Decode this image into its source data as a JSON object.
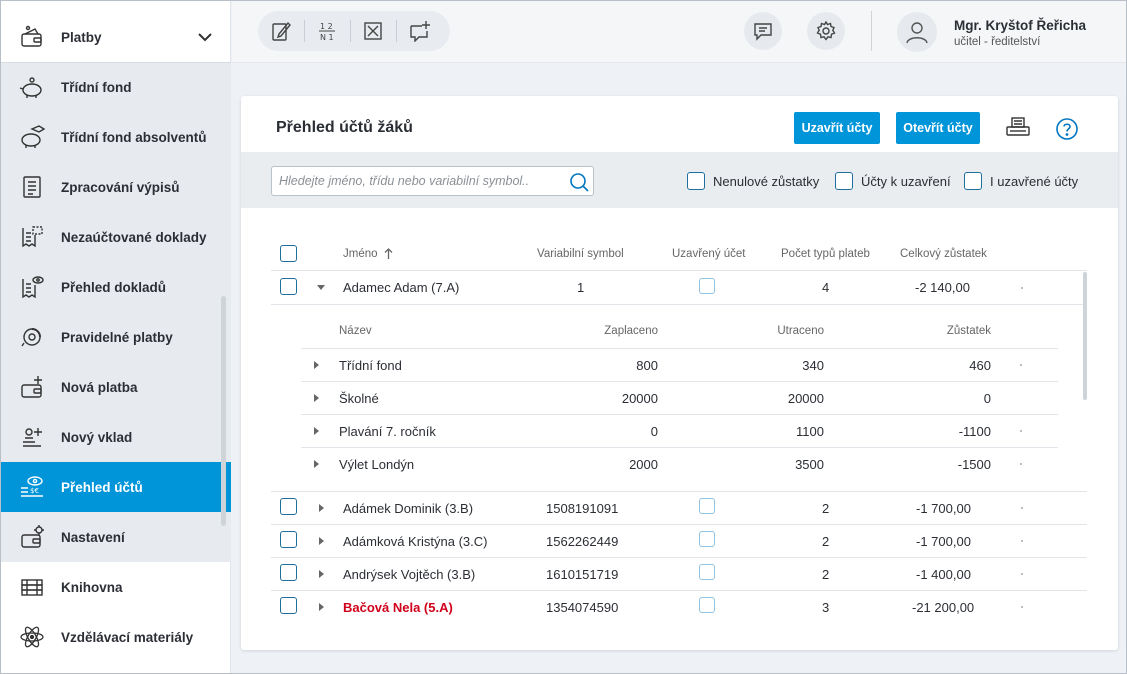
{
  "sidebar": {
    "header": {
      "label": "Platby",
      "icon": "wallet-icon"
    },
    "items": [
      {
        "label": "Třídní fond",
        "icon": "piggy-bank-icon"
      },
      {
        "label": "Třídní fond absolventů",
        "icon": "piggy-bank-graduate-icon"
      },
      {
        "label": "Zpracování výpisů",
        "icon": "statement-icon"
      },
      {
        "label": "Nezaúčtované doklady",
        "icon": "receipt-dashed-icon"
      },
      {
        "label": "Přehled dokladů",
        "icon": "receipt-eye-icon"
      },
      {
        "label": "Pravidelné platby",
        "icon": "recurring-payment-icon"
      },
      {
        "label": "Nová platba",
        "icon": "wallet-plus-icon"
      },
      {
        "label": "Nový vklad",
        "icon": "coins-plus-icon"
      },
      {
        "label": "Přehled účtů",
        "icon": "accounts-eye-icon",
        "active": true
      },
      {
        "label": "Nastavení",
        "icon": "wallet-gear-icon"
      }
    ],
    "other": [
      {
        "label": "Knihovna",
        "icon": "books-icon"
      },
      {
        "label": "Vzdělávací materiály",
        "icon": "atom-icon"
      }
    ]
  },
  "topbar": {
    "tools": [
      "edit-icon",
      "grades-icon",
      "close-box-icon",
      "add-comment-icon"
    ],
    "user": {
      "name": "Mgr. Kryštof Řeřicha",
      "role": "učitel - ředitelství"
    }
  },
  "panel": {
    "title": "Přehled účtů žáků",
    "close_accounts": "Uzavřít účty",
    "open_accounts": "Otevřít účty",
    "search_placeholder": "Hledejte jméno, třídu nebo variabilní symbol..",
    "filters": [
      "Nenulové zůstatky",
      "Účty k uzavření",
      "I uzavřené účty"
    ]
  },
  "table": {
    "columns": [
      "Jméno",
      "Variabilní symbol",
      "Uzavřený účet",
      "Počet typů plateb",
      "Celkový zůstatek"
    ],
    "expanded": {
      "name": "Adamec Adam (7.A)",
      "vs": "1",
      "types": "4",
      "balance": "-2 140,00",
      "sub_columns": [
        "Název",
        "Zaplaceno",
        "Utraceno",
        "Zůstatek"
      ],
      "sub_rows": [
        {
          "name": "Třídní fond",
          "paid": "800",
          "spent": "340",
          "balance": "460"
        },
        {
          "name": "Školné",
          "paid": "20000",
          "spent": "20000",
          "balance": "0"
        },
        {
          "name": "Plavání 7. ročník",
          "paid": "0",
          "spent": "1100",
          "balance": "-1100"
        },
        {
          "name": "Výlet Londýn",
          "paid": "2000",
          "spent": "3500",
          "balance": "-1500"
        }
      ]
    },
    "rows": [
      {
        "name": "Adámek Dominik (3.B)",
        "vs": "1508191091",
        "types": "2",
        "balance": "-1 700,00"
      },
      {
        "name": "Adámková Kristýna (3.C)",
        "vs": "1562262449",
        "types": "2",
        "balance": "-1 700,00"
      },
      {
        "name": "Andrýsek Vojtěch (3.B)",
        "vs": "1610151719",
        "types": "2",
        "balance": "-1 400,00"
      },
      {
        "name": "Bačová Nela (5.A)",
        "vs": "1354074590",
        "types": "3",
        "balance": "-21 200,00",
        "highlight_color": "#d0021b"
      }
    ]
  }
}
